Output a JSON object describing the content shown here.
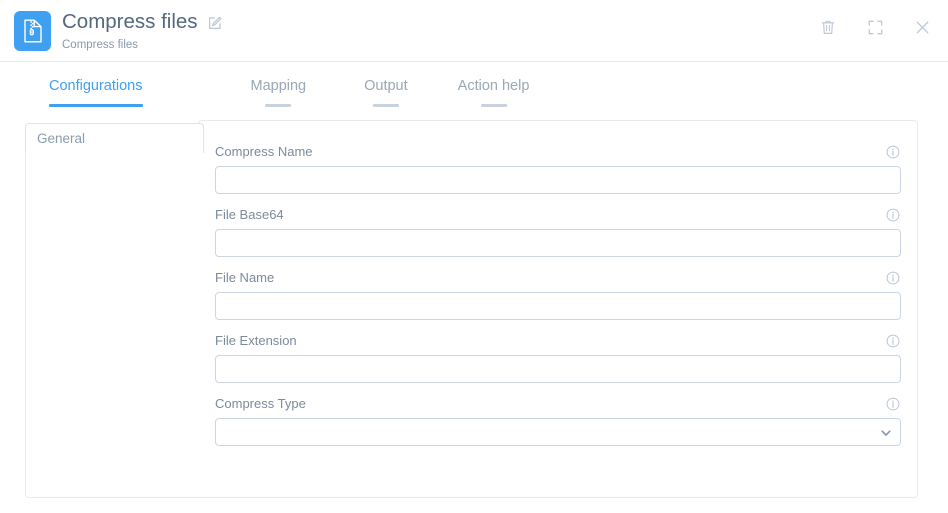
{
  "header": {
    "icon": "zip-file-icon",
    "title": "Compress files",
    "subtitle": "Compress files",
    "edit_icon": "edit-icon",
    "actions": [
      {
        "name": "delete-button",
        "icon": "trash-icon"
      },
      {
        "name": "expand-button",
        "icon": "expand-icon"
      },
      {
        "name": "close-button",
        "icon": "close-icon"
      }
    ]
  },
  "tabs": [
    {
      "label": "Configurations",
      "active": true
    },
    {
      "label": "Mapping",
      "active": false
    },
    {
      "label": "Output",
      "active": false
    },
    {
      "label": "Action help",
      "active": false
    }
  ],
  "sidebar": {
    "items": [
      {
        "label": "General",
        "active": true
      }
    ]
  },
  "form": {
    "fields": [
      {
        "label": "Compress Name",
        "type": "text",
        "value": "",
        "placeholder": "",
        "info_icon": "info-icon"
      },
      {
        "label": "File Base64",
        "type": "text",
        "value": "",
        "placeholder": "",
        "info_icon": "info-icon"
      },
      {
        "label": "File Name",
        "type": "text",
        "value": "",
        "placeholder": "",
        "info_icon": "info-icon"
      },
      {
        "label": "File Extension",
        "type": "text",
        "value": "",
        "placeholder": "",
        "info_icon": "info-icon"
      },
      {
        "label": "Compress Type",
        "type": "select",
        "value": "",
        "placeholder": "",
        "info_icon": "info-icon",
        "dropdown_icon": "chevron-down-icon"
      }
    ]
  },
  "colors": {
    "accent": "#3fa0f2",
    "title_text": "#54687e",
    "muted_text": "#8a99ab",
    "border": "#e6ebf1",
    "input_border": "#ccd6e2"
  }
}
